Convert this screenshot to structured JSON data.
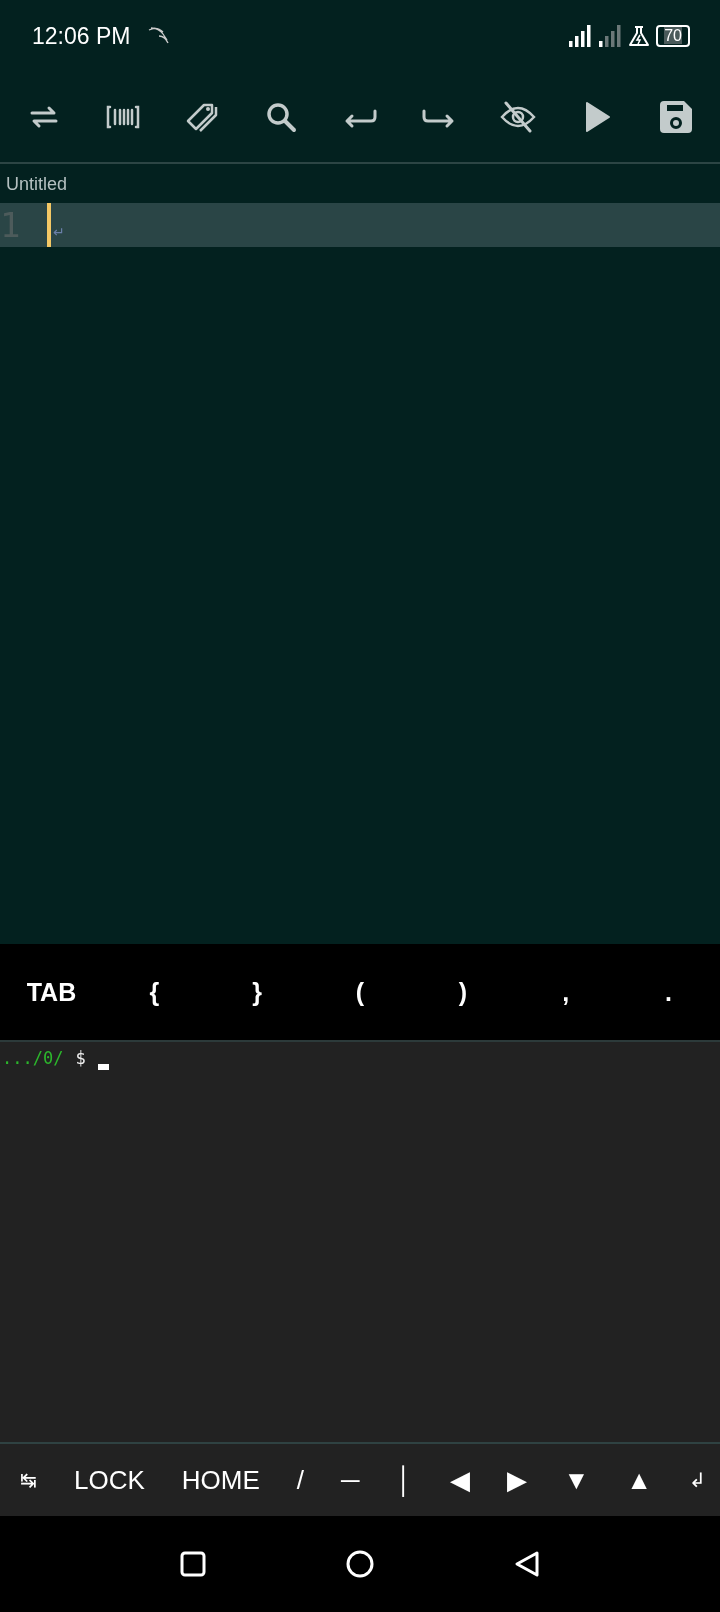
{
  "status_bar": {
    "time": "12:06 PM",
    "battery": "70"
  },
  "editor": {
    "tab_title": "Untitled",
    "lines": [
      {
        "number": "1",
        "eol_marker": "↵",
        "current": true
      }
    ]
  },
  "extra_keys": [
    "TAB",
    "{",
    "}",
    "(",
    ")",
    ",",
    "."
  ],
  "terminal": {
    "prompt_path": ".../0/",
    "prompt_symbol": "$"
  },
  "terminal_keys": [
    "↹",
    "LOCK",
    "HOME",
    "/",
    "─",
    "│",
    "◀",
    "▶",
    "▼",
    "▲",
    "↲"
  ]
}
